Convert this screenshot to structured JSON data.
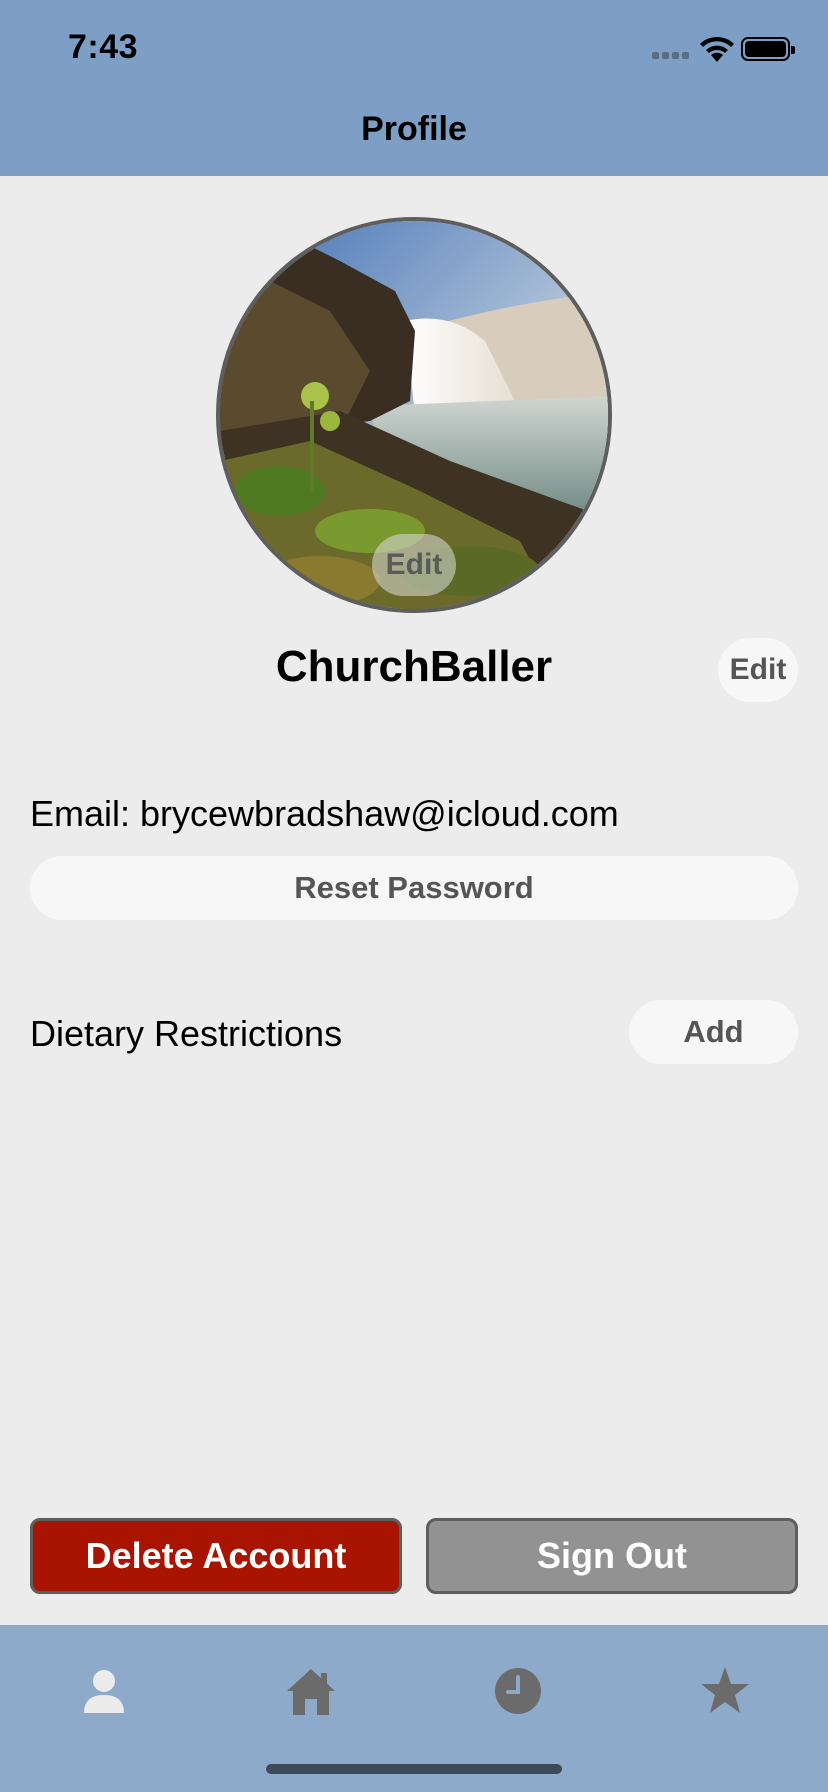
{
  "status_bar": {
    "time": "7:43"
  },
  "header": {
    "title": "Profile"
  },
  "profile": {
    "avatar_edit_label": "Edit",
    "username": "ChurchBaller",
    "username_edit_label": "Edit"
  },
  "account": {
    "email_text": "Email: brycewbradshaw@icloud.com",
    "reset_password_label": "Reset Password"
  },
  "dietary": {
    "label": "Dietary Restrictions",
    "add_label": "Add"
  },
  "actions": {
    "delete_label": "Delete Account",
    "signout_label": "Sign Out"
  },
  "tab_bar": {
    "tabs": [
      {
        "icon": "person-icon",
        "active": true
      },
      {
        "icon": "home-icon",
        "active": false
      },
      {
        "icon": "clock-icon",
        "active": false
      },
      {
        "icon": "star-icon",
        "active": false
      }
    ]
  },
  "colors": {
    "header_bg": "#7d9fc5",
    "tabbar_bg": "#8eaacb",
    "delete_bg": "#a81400",
    "signout_bg": "#929292",
    "page_bg": "#ececec"
  }
}
